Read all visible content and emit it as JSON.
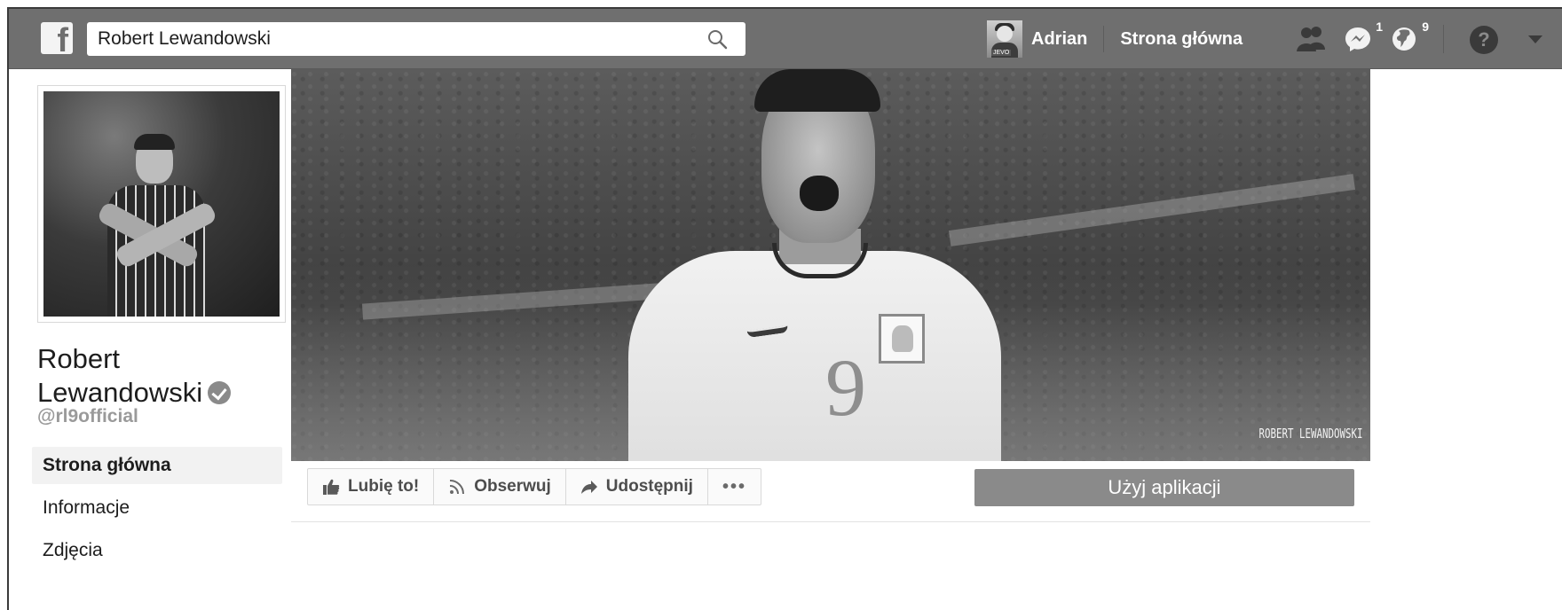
{
  "topbar": {
    "logo_letter": "f",
    "search_value": "Robert Lewandowski",
    "user_name": "Adrian",
    "avatar_tag": "JEVO",
    "home_label": "Strona główna",
    "messages_badge": "1",
    "notifications_badge": "9",
    "help_glyph": "?"
  },
  "sidebar": {
    "page_name_line1": "Robert",
    "page_name_line2": "Lewandowski",
    "handle": "@rl9official",
    "items": [
      {
        "label": "Strona główna",
        "active": true
      },
      {
        "label": "Informacje",
        "active": false
      },
      {
        "label": "Zdjęcia",
        "active": false
      }
    ]
  },
  "cover": {
    "caption": "ROBERT LEWANDOWSKI",
    "shirt_number": "9"
  },
  "actions": {
    "like_label": "Lubię to!",
    "follow_label": "Obserwuj",
    "share_label": "Udostępnij",
    "more_label": "•••",
    "use_app_label": "Użyj aplikacji"
  },
  "icons": {
    "logo": "facebook-logo-icon",
    "search": "search-icon",
    "friends": "friend-requests-icon",
    "messages": "messenger-icon",
    "notifications": "globe-icon",
    "help": "help-icon",
    "menu": "caret-down-icon",
    "verified": "verified-badge-icon",
    "like": "thumbs-up-icon",
    "follow": "rss-icon",
    "share": "share-arrow-icon"
  },
  "colors": {
    "topbar": "#6f6f6f",
    "use_app_button": "#8a8a8a",
    "active_nav_bg": "#f2f2f2",
    "handle_text": "#9a9a9a"
  }
}
